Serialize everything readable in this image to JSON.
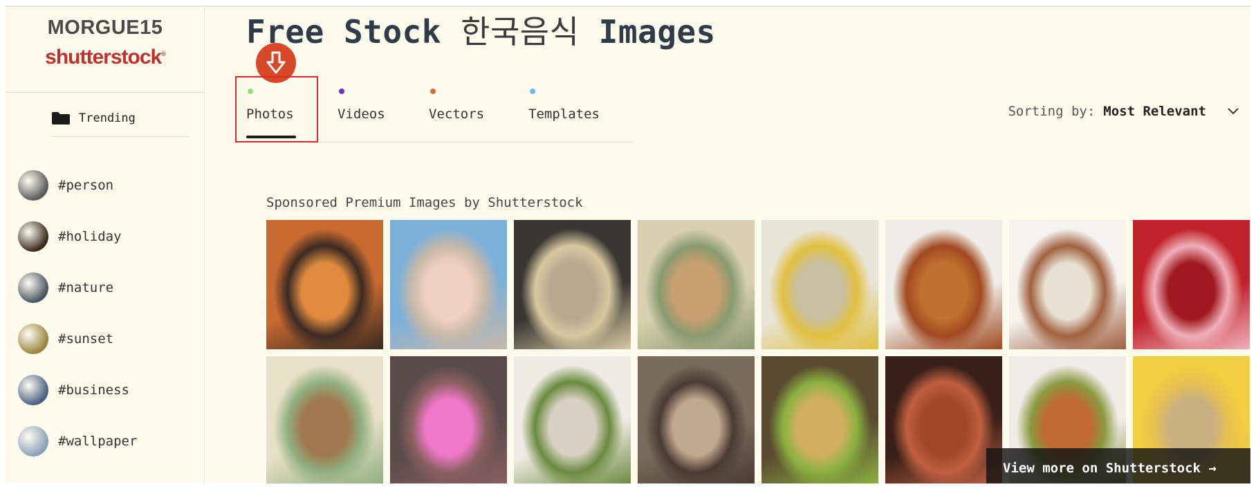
{
  "brand": {
    "title": "MORGUE15",
    "logo": "shutterstock"
  },
  "sidebar": {
    "trending_label": "Trending",
    "tags": [
      {
        "label": "#person",
        "color": "#5a5a5a"
      },
      {
        "label": "#holiday",
        "color": "#3a2a1a"
      },
      {
        "label": "#nature",
        "color": "#4a5560"
      },
      {
        "label": "#sunset",
        "color": "#9a8440"
      },
      {
        "label": "#business",
        "color": "#4a6080"
      },
      {
        "label": "#wallpaper",
        "color": "#8aa0b8"
      }
    ]
  },
  "main": {
    "title_prefix": "Free Stock",
    "title_korean": "한국음식",
    "title_suffix": "Images",
    "tabs": [
      {
        "label": "Photos",
        "dot_color": "#8fe07a",
        "active": true
      },
      {
        "label": "Videos",
        "dot_color": "#6a2fd0"
      },
      {
        "label": "Vectors",
        "dot_color": "#d0703a"
      },
      {
        "label": "Templates",
        "dot_color": "#6ab8e8"
      }
    ],
    "sorting_label": "Sorting by:",
    "sorting_value": "Most Relevant",
    "sponsored_label": "Sponsored Premium Images by Shutterstock",
    "view_more_label": "View more on Shutterstock →",
    "images": [
      {
        "name": "fried-octopus-pan",
        "colors": [
          "#c96a30",
          "#e08a40",
          "#3a2a22"
        ]
      },
      {
        "name": "woman-bucket-hat",
        "colors": [
          "#7db0d8",
          "#f0d0c0",
          "#c7b8a8"
        ]
      },
      {
        "name": "braised-dish-bowl",
        "colors": [
          "#3a3632",
          "#b8a890",
          "#d8c8a0"
        ]
      },
      {
        "name": "rice-cake-box",
        "colors": [
          "#d8d0b0",
          "#c8a070",
          "#8a9a70"
        ]
      },
      {
        "name": "dumpling-soup-bowl",
        "colors": [
          "#e8e4d8",
          "#c8c0a0",
          "#e0c040"
        ]
      },
      {
        "name": "yakgwa-cookies",
        "colors": [
          "#f0ede8",
          "#c07030",
          "#a04a20"
        ]
      },
      {
        "name": "tteokguk-soup",
        "colors": [
          "#f5f3ee",
          "#e8e0d0",
          "#a06040"
        ]
      },
      {
        "name": "red-new-year-bg",
        "colors": [
          "#c0222a",
          "#a01820",
          "#f0b0b8"
        ]
      },
      {
        "name": "rice-cakes-wooden-box",
        "colors": [
          "#e8e0c8",
          "#a07850",
          "#90b080"
        ]
      },
      {
        "name": "neon-grill-sign",
        "colors": [
          "#5a4a4a",
          "#f078c8",
          "#8a6060"
        ]
      },
      {
        "name": "rice-cake-bowl-closeup",
        "colors": [
          "#f0ece4",
          "#d8d0c0",
          "#6a8a40"
        ]
      },
      {
        "name": "woman-cooking",
        "colors": [
          "#7a6a5a",
          "#c0a890",
          "#4a3a30"
        ]
      },
      {
        "name": "pancake-platter",
        "colors": [
          "#5a4a30",
          "#d0b060",
          "#8ab040"
        ]
      },
      {
        "name": "bbq-grill",
        "colors": [
          "#3a2018",
          "#a04828",
          "#c06040"
        ]
      },
      {
        "name": "banchan-spread",
        "colors": [
          "#f0ece8",
          "#c06a30",
          "#8a9a40"
        ]
      },
      {
        "name": "soup-with-chopsticks",
        "colors": [
          "#f0d040",
          "#c8b080",
          "#e8c050"
        ]
      }
    ]
  }
}
